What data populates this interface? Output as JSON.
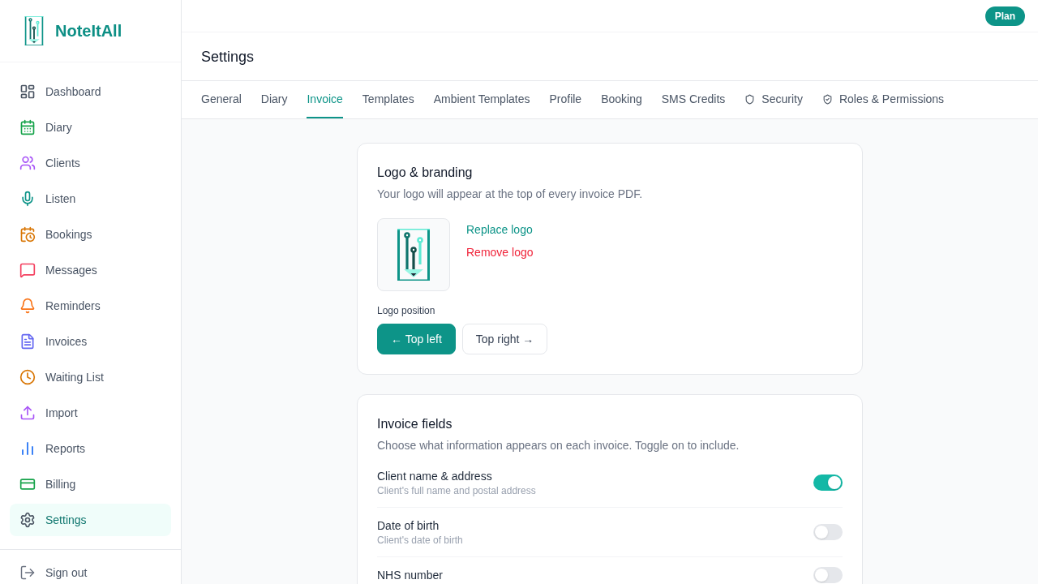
{
  "sidebar": {
    "brand": "NoteItAll",
    "items": [
      {
        "label": "Dashboard",
        "color": "#4b5563",
        "selected": false
      },
      {
        "label": "Diary",
        "color": "#16a34a",
        "selected": false
      },
      {
        "label": "Clients",
        "color": "#a855f7",
        "selected": false
      },
      {
        "label": "Listen",
        "color": "#0d9488",
        "selected": false
      },
      {
        "label": "Bookings",
        "color": "#d97706",
        "selected": false
      },
      {
        "label": "Messages",
        "color": "#f43f5e",
        "selected": false
      },
      {
        "label": "Reminders",
        "color": "#f97316",
        "selected": false
      },
      {
        "label": "Invoices",
        "color": "#6366f1",
        "selected": false
      },
      {
        "label": "Waiting List",
        "color": "#d97706",
        "selected": false
      },
      {
        "label": "Import",
        "color": "#a855f7",
        "selected": false
      },
      {
        "label": "Reports",
        "color": "#3b82f6",
        "selected": false
      },
      {
        "label": "Billing",
        "color": "#16a34a",
        "selected": false
      },
      {
        "label": "Settings",
        "color": "#4b5563",
        "selected": true
      }
    ],
    "sign_out": "Sign out"
  },
  "top_bar": {
    "plan_button": "Plan"
  },
  "page": {
    "title": "Settings"
  },
  "tabs": [
    {
      "label": "General",
      "selected": false
    },
    {
      "label": "Diary",
      "selected": false
    },
    {
      "label": "Invoice",
      "selected": true
    },
    {
      "label": "Templates",
      "selected": false
    },
    {
      "label": "Ambient Templates",
      "selected": false
    },
    {
      "label": "Profile",
      "selected": false
    },
    {
      "label": "Booking",
      "selected": false
    },
    {
      "label": "SMS Credits",
      "selected": false
    },
    {
      "label": "Security",
      "selected": false
    },
    {
      "label": "Roles & Permissions",
      "selected": false
    }
  ],
  "logo_card": {
    "title": "Logo & branding",
    "description": "Your logo will appear at the top of every invoice PDF.",
    "replace_link": "Replace logo",
    "remove_link": "Remove logo",
    "position_label": "Logo position",
    "position_options": [
      {
        "label": "← Top left",
        "selected": true
      },
      {
        "label": "Top right →",
        "selected": false
      }
    ]
  },
  "fields_card": {
    "title": "Invoice fields",
    "description": "Choose what information appears on each invoice. Toggle on to include.",
    "rows": [
      {
        "label": "Client name & address",
        "hint": "Client's full name and postal address",
        "on": true
      },
      {
        "label": "Date of birth",
        "hint": "Client's date of birth",
        "on": false
      },
      {
        "label": "NHS number",
        "on": false
      }
    ]
  }
}
